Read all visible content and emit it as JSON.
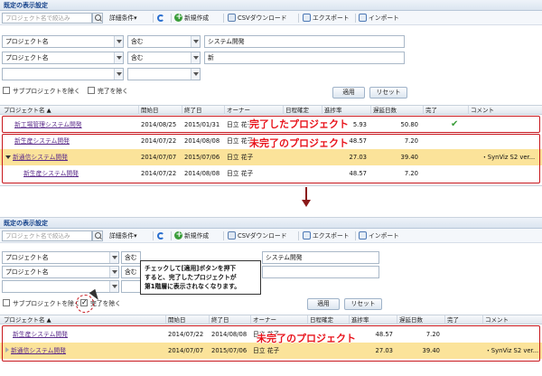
{
  "top": {
    "header_title": "既定の表示設定",
    "toolbar": {
      "search_placeholder": "プロジェクト名で絞込み",
      "detail_conditions": "詳細条件▾",
      "new_label": "新規作成",
      "csv_label": "CSVダウンロード",
      "export_label": "エクスポート",
      "import_label": "インポート"
    },
    "filters": [
      {
        "field": "プロジェクト名",
        "operator": "含む",
        "value": "システム開発"
      },
      {
        "field": "プロジェクト名",
        "operator": "含む",
        "value": "新"
      },
      {
        "field": "",
        "operator": "",
        "value": ""
      }
    ],
    "checkbox_sub": "サブプロジェクトを除く",
    "checkbox_done": "完了を除く",
    "checkbox_sub_checked": false,
    "checkbox_done_checked": false,
    "apply_label": "適用",
    "reset_label": "リセット",
    "columns": [
      "プロジェクト名",
      "開始日",
      "終了日",
      "オーナー",
      "日程確定",
      "進捗率",
      "遅延日数",
      "完了",
      "コメント"
    ],
    "rows": [
      {
        "name": "新工場管理システム開発",
        "start": "2014/08/25",
        "end": "2015/01/31",
        "owner": "日立 花子",
        "fixed": "",
        "progress": "5.93",
        "delay": "50.80",
        "done": "✔",
        "comment": "",
        "highlight": false
      },
      {
        "name": "新生産システム開発",
        "start": "2014/07/22",
        "end": "2014/08/08",
        "owner": "日立 花子",
        "fixed": "",
        "progress": "48.57",
        "delay": "7.20",
        "done": "",
        "comment": "",
        "highlight": false
      },
      {
        "name": "新通信システム開発",
        "start": "2014/07/07",
        "end": "2015/07/06",
        "owner": "日立 花子",
        "fixed": "",
        "progress": "27.03",
        "delay": "39.40",
        "done": "",
        "comment": "・SynViz S2 ver...",
        "highlight": true
      },
      {
        "name": "新生産システム開発",
        "start": "2014/07/22",
        "end": "2014/08/08",
        "owner": "日立 花子",
        "fixed": "",
        "progress": "48.57",
        "delay": "7.20",
        "done": "",
        "comment": "",
        "highlight": false
      }
    ],
    "callout_done": "完了したプロジェクト",
    "callout_not_done": "未完了のプロジェクト"
  },
  "bottom": {
    "header_title": "既定の表示設定",
    "toolbar": {
      "search_placeholder": "プロジェクト名で絞込み",
      "detail_conditions": "詳細条件▾",
      "new_label": "新規作成",
      "csv_label": "CSVダウンロード",
      "export_label": "エクスポート",
      "import_label": "インポート"
    },
    "filters": [
      {
        "field": "プロジェクト名",
        "operator": "含む",
        "value": "システム開発"
      },
      {
        "field": "プロジェクト名",
        "operator": "含む",
        "value": ""
      },
      {
        "field": "",
        "operator": "",
        "value": ""
      }
    ],
    "checkbox_sub": "サブプロジェクトを除く",
    "checkbox_done": "完了を除く",
    "checkbox_sub_checked": false,
    "checkbox_done_checked": true,
    "apply_label": "適用",
    "reset_label": "リセット",
    "columns": [
      "プロジェクト名",
      "開始日",
      "終了日",
      "オーナー",
      "日程確定",
      "進捗率",
      "遅延日数",
      "完了",
      "コメント"
    ],
    "rows": [
      {
        "name": "新生産システム開発",
        "start": "2014/07/22",
        "end": "2014/08/08",
        "owner": "日立 花子",
        "fixed": "",
        "progress": "48.57",
        "delay": "7.20",
        "done": "",
        "comment": "",
        "highlight": false
      },
      {
        "name": "新通信システム開発",
        "start": "2014/07/07",
        "end": "2015/07/06",
        "owner": "日立 花子",
        "fixed": "",
        "progress": "27.03",
        "delay": "39.40",
        "done": "",
        "comment": "・SynViz S2 ver...",
        "highlight": true
      }
    ],
    "callout_not_done": "未完了のプロジェクト",
    "tooltip_lines": [
      "チェックして[適用]ボタンを押下",
      "すると、完了したプロジェクトが",
      "第1階層に表示されなくなります。"
    ]
  },
  "colors": {
    "accent_red": "#e8141c",
    "highlight_row": "#fbe39a",
    "link": "#5a2a8a",
    "header_text": "#15428b"
  }
}
